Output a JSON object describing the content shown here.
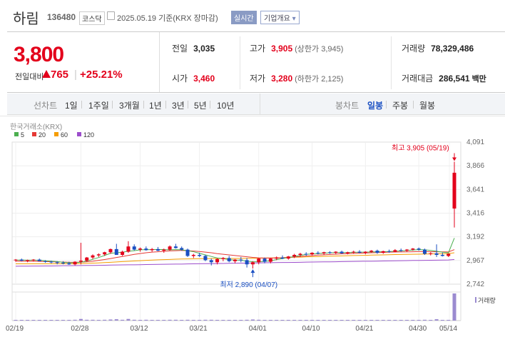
{
  "header": {
    "name": "하림",
    "code": "136480",
    "market": "코스닥",
    "date": "2025.05.19 기준(KRX 장마감)",
    "realtime_btn": "실시간",
    "company_btn": "기업개요",
    "company_btn_arrow": "▾"
  },
  "summary": {
    "price": "3,800",
    "change_label": "전일대비",
    "change_value": "765",
    "change_pct": "+25.21%",
    "prev_close": {
      "label": "전일",
      "value": "3,035"
    },
    "open": {
      "label": "시가",
      "value": "3,460"
    },
    "high": {
      "label": "고가",
      "value": "3,905",
      "limit": "(상한가 3,945)"
    },
    "low": {
      "label": "저가",
      "value": "3,280",
      "limit": "(하한가 2,125)"
    },
    "volume": {
      "label": "거래량",
      "value": "78,329,486"
    },
    "amount": {
      "label": "거래대금",
      "value": "286,541",
      "unit": "백만"
    }
  },
  "tabs": {
    "line_chart": "선차트",
    "periods": [
      "1일",
      "1주일",
      "3개월",
      "1년",
      "3년",
      "5년",
      "10년"
    ],
    "candle_chart": "봉차트",
    "candle_periods": [
      "일봉",
      "주봉",
      "월봉"
    ],
    "candle_selected": "일봉"
  },
  "colors": {
    "up": "#e3001b",
    "down": "#1a4fc2",
    "ma5": "#4caf50",
    "ma20": "#e53935",
    "ma60": "#f59d00",
    "ma120": "#9c4dcc",
    "volume": "#9b8bd0"
  },
  "chart_data": {
    "type": "candlestick",
    "source": "한국거래소(KRX)",
    "legend": [
      "5",
      "20",
      "60",
      "120"
    ],
    "x_tick_labels": [
      "02/19",
      "02/28",
      "03/12",
      "03/21",
      "04/01",
      "04/10",
      "04/21",
      "04/30",
      "05/14"
    ],
    "y_tick_labels": [
      "4,091",
      "3,866",
      "3,641",
      "3,416",
      "3,192",
      "2,967",
      "2,742"
    ],
    "ylim": [
      2742,
      4091
    ],
    "high_annotation": "최고 3,905 (05/19)",
    "low_annotation": "최저 2,890 (04/07)",
    "volume_label": "거래량",
    "candles": [
      [
        2970,
        2980,
        2955,
        2975
      ],
      [
        2975,
        2985,
        2960,
        2965
      ],
      [
        2965,
        2975,
        2950,
        2970
      ],
      [
        2970,
        2980,
        2960,
        2975
      ],
      [
        2975,
        2985,
        2965,
        2960
      ],
      [
        2960,
        2970,
        2945,
        2955
      ],
      [
        2955,
        2965,
        2940,
        2950
      ],
      [
        2950,
        2960,
        2930,
        2945
      ],
      [
        2945,
        2960,
        2930,
        2940
      ],
      [
        2940,
        2955,
        2925,
        2930
      ],
      [
        2930,
        2960,
        2920,
        2955
      ],
      [
        2955,
        3135,
        2930,
        2965
      ],
      [
        2965,
        3000,
        2955,
        2995
      ],
      [
        2995,
        3025,
        2980,
        3015
      ],
      [
        3015,
        3035,
        3000,
        3025
      ],
      [
        3025,
        3050,
        3010,
        3045
      ],
      [
        3045,
        3080,
        3030,
        3075
      ],
      [
        3075,
        3125,
        3050,
        3020
      ],
      [
        3020,
        3060,
        3010,
        3050
      ],
      [
        3050,
        3150,
        3040,
        3100
      ],
      [
        3100,
        3120,
        3060,
        3070
      ],
      [
        3070,
        3090,
        3050,
        3080
      ],
      [
        3080,
        3100,
        3060,
        3065
      ],
      [
        3065,
        3085,
        3050,
        3075
      ],
      [
        3075,
        3095,
        3055,
        3060
      ],
      [
        3060,
        3080,
        3040,
        3070
      ],
      [
        3070,
        3110,
        3060,
        3100
      ],
      [
        3100,
        3125,
        3080,
        3085
      ],
      [
        3085,
        3100,
        3060,
        3070
      ],
      [
        3070,
        3080,
        3000,
        3010
      ],
      [
        3010,
        3030,
        2990,
        3020
      ],
      [
        3020,
        3040,
        3000,
        3010
      ],
      [
        3010,
        3020,
        2960,
        2970
      ],
      [
        2970,
        2985,
        2920,
        2950
      ],
      [
        2950,
        2990,
        2930,
        2980
      ],
      [
        2980,
        3000,
        2960,
        2990
      ],
      [
        2990,
        3010,
        2950,
        2960
      ],
      [
        2960,
        2980,
        2940,
        2975
      ],
      [
        2975,
        3000,
        2950,
        2970
      ],
      [
        2970,
        2990,
        2900,
        2930
      ],
      [
        2930,
        2960,
        2890,
        2950
      ],
      [
        2950,
        2990,
        2930,
        2985
      ],
      [
        2985,
        2995,
        2940,
        2955
      ],
      [
        2955,
        2990,
        2940,
        2985
      ],
      [
        2985,
        3005,
        2970,
        2995
      ],
      [
        2995,
        3015,
        2980,
        2985
      ],
      [
        2985,
        3010,
        2975,
        3005
      ],
      [
        3005,
        3030,
        2990,
        3020
      ],
      [
        3020,
        3040,
        3000,
        3030
      ],
      [
        3030,
        3045,
        3010,
        3025
      ],
      [
        3025,
        3045,
        3015,
        3040
      ],
      [
        3040,
        3055,
        3025,
        3035
      ],
      [
        3035,
        3050,
        3020,
        3045
      ],
      [
        3045,
        3055,
        3030,
        3040
      ],
      [
        3040,
        3055,
        3025,
        3050
      ],
      [
        3050,
        3060,
        3030,
        3035
      ],
      [
        3035,
        3050,
        3025,
        3045
      ],
      [
        3045,
        3060,
        3030,
        3050
      ],
      [
        3050,
        3065,
        3035,
        3040
      ],
      [
        3040,
        3055,
        3025,
        3050
      ],
      [
        3050,
        3065,
        3040,
        3060
      ],
      [
        3060,
        3070,
        3030,
        3040
      ],
      [
        3040,
        3060,
        3030,
        3055
      ],
      [
        3055,
        3070,
        3040,
        3050
      ],
      [
        3050,
        3075,
        3045,
        3065
      ],
      [
        3065,
        3080,
        3050,
        3060
      ],
      [
        3060,
        3075,
        3050,
        3070
      ],
      [
        3070,
        3085,
        3060,
        3080
      ],
      [
        3080,
        3090,
        3060,
        3070
      ],
      [
        3070,
        3080,
        3020,
        3030
      ],
      [
        3030,
        3045,
        3015,
        3035
      ],
      [
        3035,
        3120,
        3000,
        3020
      ],
      [
        3020,
        3040,
        3005,
        3010
      ],
      [
        3010,
        3035,
        3000,
        3030
      ],
      [
        3460,
        3905,
        3280,
        3800
      ]
    ],
    "ma5": [
      2970,
      2972,
      2970,
      2970,
      2969,
      2965,
      2960,
      2956,
      2950,
      2945,
      2946,
      2950,
      2962,
      2978,
      2995,
      3015,
      3035,
      3040,
      3045,
      3055,
      3060,
      3068,
      3070,
      3070,
      3072,
      3070,
      3068,
      3070,
      3068,
      3060,
      3050,
      3035,
      3020,
      3005,
      2990,
      2985,
      2975,
      2970,
      2970,
      2960,
      2955,
      2955,
      2958,
      2965,
      2975,
      2985,
      2995,
      3005,
      3015,
      3025,
      3030,
      3033,
      3036,
      3040,
      3042,
      3042,
      3042,
      3044,
      3046,
      3046,
      3048,
      3050,
      3050,
      3052,
      3054,
      3058,
      3062,
      3066,
      3070,
      3068,
      3062,
      3055,
      3045,
      3040,
      3180
    ],
    "ma20": [
      2960,
      2960,
      2960,
      2959,
      2958,
      2956,
      2955,
      2953,
      2952,
      2950,
      2950,
      2951,
      2955,
      2960,
      2968,
      2976,
      2985,
      2995,
      3005,
      3015,
      3025,
      3033,
      3040,
      3046,
      3050,
      3054,
      3058,
      3060,
      3062,
      3060,
      3056,
      3052,
      3046,
      3040,
      3032,
      3026,
      3020,
      3014,
      3008,
      3002,
      2996,
      2992,
      2990,
      2990,
      2990,
      2992,
      2996,
      3000,
      3005,
      3010,
      3014,
      3018,
      3021,
      3024,
      3027,
      3030,
      3032,
      3034,
      3036,
      3038,
      3040,
      3042,
      3044,
      3046,
      3047,
      3048,
      3049,
      3050,
      3051,
      3051,
      3050,
      3050,
      3049,
      3048,
      3070
    ],
    "ma60": [
      2935,
      2935,
      2935,
      2935,
      2935,
      2935,
      2935,
      2936,
      2936,
      2936,
      2937,
      2938,
      2940,
      2942,
      2944,
      2947,
      2950,
      2953,
      2956,
      2959,
      2962,
      2965,
      2968,
      2971,
      2973,
      2975,
      2977,
      2979,
      2981,
      2982,
      2983,
      2984,
      2985,
      2985,
      2985,
      2985,
      2986,
      2986,
      2987,
      2987,
      2988,
      2989,
      2990,
      2991,
      2993,
      2994,
      2996,
      2998,
      2999,
      3001,
      3003,
      3004,
      3006,
      3008,
      3009,
      3011,
      3012,
      3014,
      3015,
      3016,
      3018,
      3019,
      3020,
      3022,
      3023,
      3024,
      3025,
      3026,
      3027,
      3028,
      3029,
      3030,
      3031,
      3032,
      3040
    ],
    "ma120": [
      2912,
      2913,
      2913,
      2914,
      2914,
      2915,
      2915,
      2916,
      2917,
      2917,
      2918,
      2919,
      2920,
      2920,
      2921,
      2922,
      2923,
      2924,
      2925,
      2926,
      2926,
      2927,
      2928,
      2929,
      2930,
      2931,
      2932,
      2933,
      2933,
      2934,
      2935,
      2936,
      2937,
      2937,
      2938,
      2939,
      2940,
      2941,
      2941,
      2942,
      2943,
      2944,
      2945,
      2946,
      2947,
      2948,
      2948,
      2949,
      2950,
      2951,
      2952,
      2953,
      2954,
      2954,
      2955,
      2956,
      2957,
      2958,
      2959,
      2960,
      2960,
      2961,
      2962,
      2963,
      2964,
      2965,
      2966,
      2967,
      2967,
      2968,
      2969,
      2970,
      2971,
      2972,
      2976
    ],
    "volume": [
      0.02,
      0.02,
      0.01,
      0.02,
      0.01,
      0.02,
      0.02,
      0.02,
      0.01,
      0.02,
      0.03,
      0.06,
      0.03,
      0.03,
      0.02,
      0.03,
      0.04,
      0.05,
      0.03,
      0.06,
      0.03,
      0.02,
      0.03,
      0.02,
      0.02,
      0.02,
      0.03,
      0.03,
      0.02,
      0.03,
      0.02,
      0.02,
      0.03,
      0.03,
      0.02,
      0.02,
      0.02,
      0.02,
      0.02,
      0.03,
      0.04,
      0.03,
      0.02,
      0.02,
      0.02,
      0.02,
      0.02,
      0.02,
      0.02,
      0.02,
      0.02,
      0.02,
      0.02,
      0.02,
      0.02,
      0.02,
      0.02,
      0.02,
      0.02,
      0.02,
      0.02,
      0.02,
      0.02,
      0.02,
      0.02,
      0.02,
      0.02,
      0.02,
      0.02,
      0.03,
      0.02,
      0.05,
      0.02,
      0.02,
      1.0
    ]
  }
}
